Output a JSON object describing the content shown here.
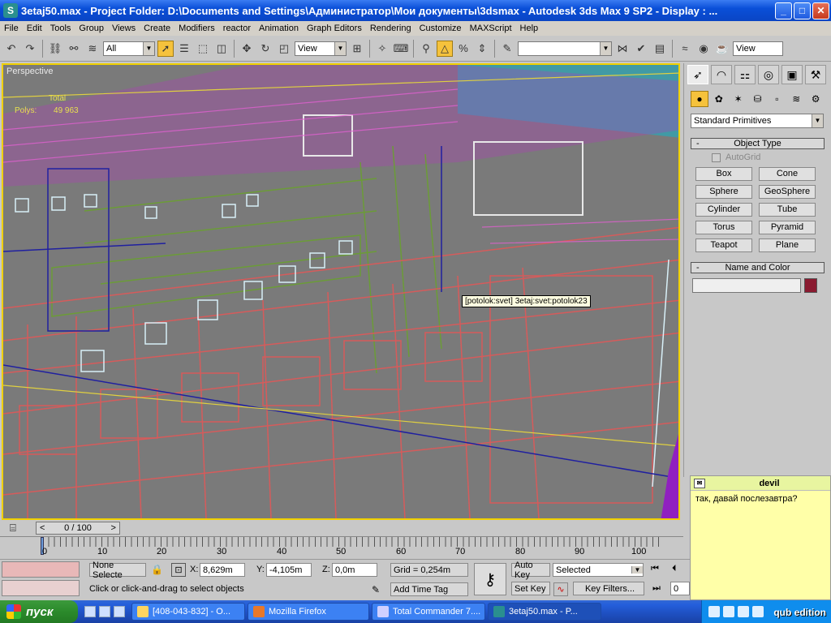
{
  "window": {
    "title": "3etaj50.max   -   Project Folder: D:\\Documents and Settings\\Администратор\\Мои документы\\3dsmax    -   Autodesk 3ds Max 9 SP2    -   Display : ...",
    "minimize": "_",
    "maximize": "□",
    "close": "✕"
  },
  "menu": [
    "File",
    "Edit",
    "Tools",
    "Group",
    "Views",
    "Create",
    "Modifiers",
    "reactor",
    "Animation",
    "Graph Editors",
    "Rendering",
    "Customize",
    "MAXScript",
    "Help"
  ],
  "toolbar": {
    "selection_filter": "All",
    "ref_coord": "View",
    "named_selection": "",
    "render_view": "View"
  },
  "viewport": {
    "label": "Perspective",
    "stats": {
      "header": "Total",
      "polys_label": "Polys:",
      "polys_value": "49 963"
    },
    "tooltip": "[potolok:svet] 3etaj:svet:potolok23"
  },
  "command_panel": {
    "category": "Standard Primitives",
    "object_type_header": "Object Type",
    "autogrid": "AutoGrid",
    "buttons": [
      "Box",
      "Cone",
      "Sphere",
      "GeoSphere",
      "Cylinder",
      "Tube",
      "Torus",
      "Pyramid",
      "Teapot",
      "Plane"
    ],
    "name_color_header": "Name and Color",
    "object_name": "",
    "object_color": "#8a1a30"
  },
  "chat": {
    "user": "devil",
    "message": "так, давай послезавтра?"
  },
  "timeline": {
    "position": "0 / 100",
    "ruler_labels": [
      "0",
      "10",
      "20",
      "30",
      "40",
      "50",
      "60",
      "70",
      "80",
      "90",
      "100"
    ]
  },
  "status": {
    "selection": "None Selecte",
    "x_label": "X:",
    "x_value": "8,629m",
    "y_label": "Y:",
    "y_value": "-4,105m",
    "z_label": "Z:",
    "z_value": "0,0m",
    "grid": "Grid = 0,254m",
    "prompt": "Click or click-and-drag to select objects",
    "add_time_tag": "Add Time Tag",
    "auto_key": "Auto Key",
    "set_key": "Set Key",
    "key_mode": "Selected",
    "key_filters": "Key Filters...",
    "frame": "0"
  },
  "taskbar": {
    "start": "пуск",
    "items": [
      "[408-043-832] - O...",
      "Mozilla Firefox",
      "Total Commander 7....",
      "3etaj50.max - P..."
    ],
    "watermark": "qub edition"
  }
}
